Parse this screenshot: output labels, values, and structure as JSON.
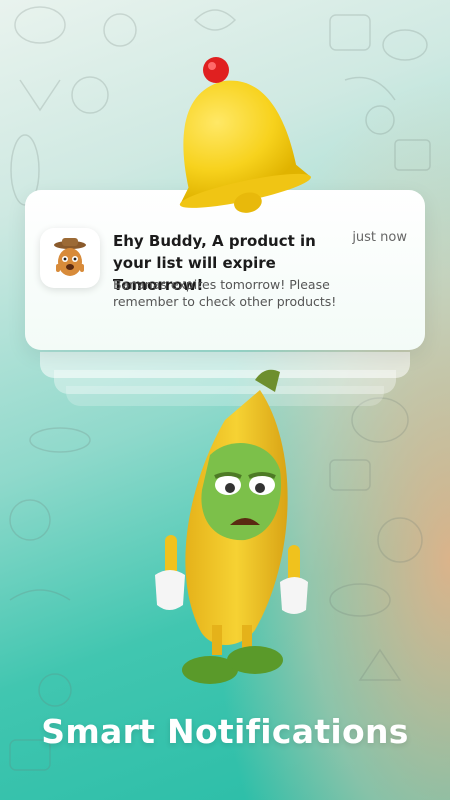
{
  "notification": {
    "title": "Ehy Buddy, A product in your list will expire Tomorrow!",
    "time": "just now",
    "body": "Bananas expires tomorrow! Please remember to check other products!",
    "app_icon": "mascot-icon"
  },
  "headline": "Smart Notifications",
  "colors": {
    "teal": "#27bca6",
    "peach": "#f6b084",
    "bell_yellow": "#f7d21d",
    "bell_dot_red": "#e02020",
    "banana_yellow": "#f6d233",
    "face_green": "#7cc04a"
  }
}
